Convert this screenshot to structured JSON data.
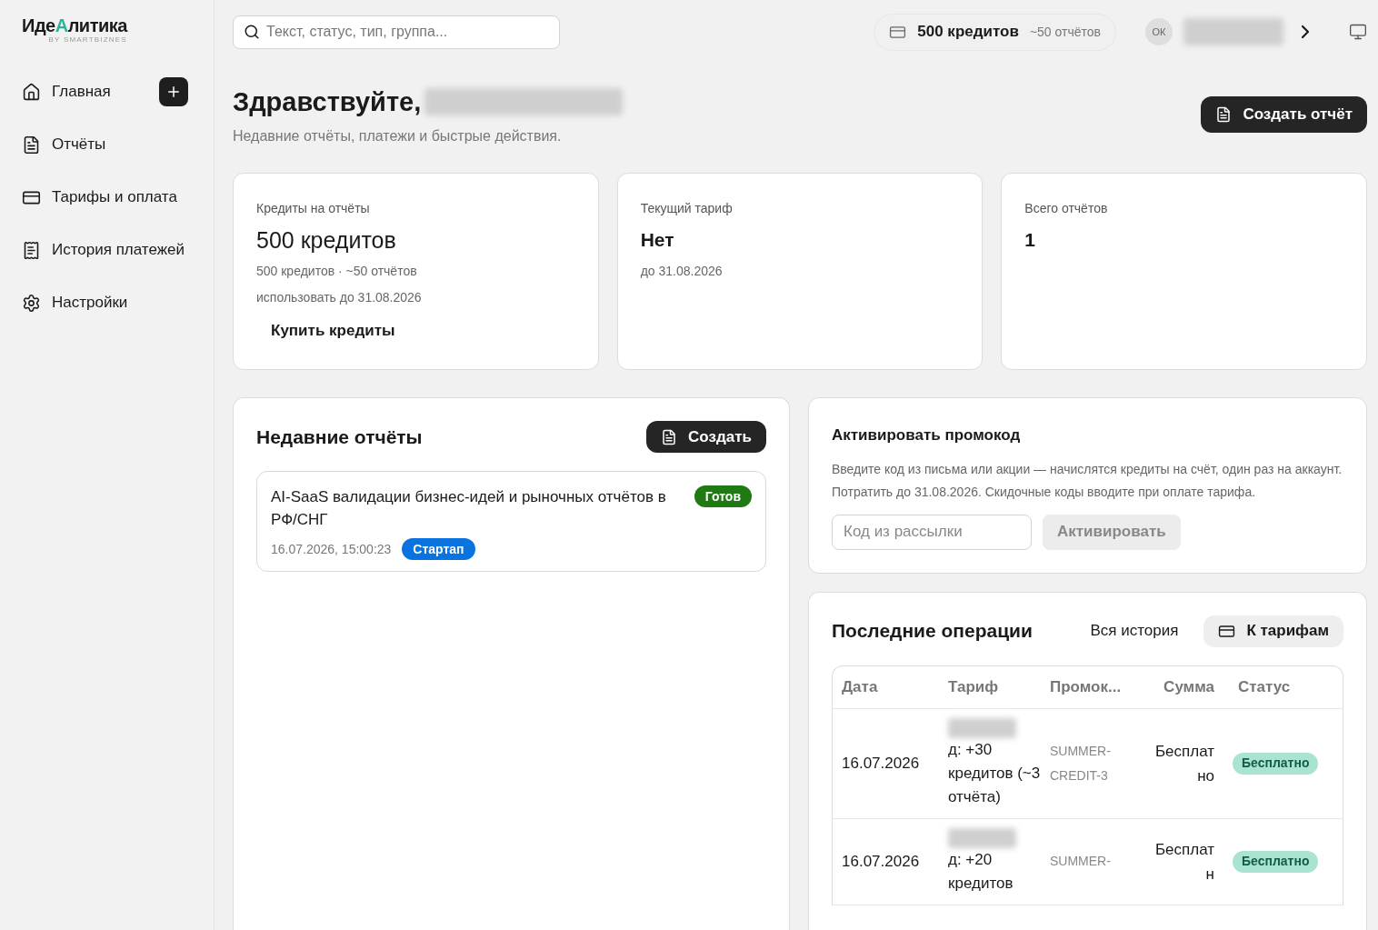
{
  "logo": {
    "name_start": "Иде",
    "name_accent": "А",
    "name_end": "литика",
    "tagline": "BY SMARTBIZNES"
  },
  "sidebar": {
    "items": [
      {
        "label": "Главная"
      },
      {
        "label": "Отчёты"
      },
      {
        "label": "Тарифы и оплата"
      },
      {
        "label": "История платежей"
      },
      {
        "label": "Настройки"
      }
    ]
  },
  "topbar": {
    "search_placeholder": "Текст, статус, тип, группа...",
    "credits": "500 кредитов",
    "reports_estimate": "~50 отчётов",
    "avatar": "ОК"
  },
  "header": {
    "greeting": "Здравствуйте,",
    "subtitle": "Недавние отчёты, платежи и быстрые действия.",
    "create_button": "Создать отчёт"
  },
  "stats": [
    {
      "label": "Кредиты на отчёты",
      "value": "500 кредитов",
      "lines": [
        "500 кредитов · ~50 отчётов",
        "использовать до 31.08.2026"
      ],
      "action": "Купить кредиты",
      "kind": "amount"
    },
    {
      "label": "Текущий тариф",
      "value": "Нет",
      "lines": [
        "до 31.08.2026"
      ],
      "kind": "plain"
    },
    {
      "label": "Всего отчётов",
      "value": "1",
      "kind": "plain"
    }
  ],
  "recent_reports": {
    "title": "Недавние отчёты",
    "create_button": "Создать",
    "items": [
      {
        "title": "AI-SaaS валидации бизнес-идей и рыночных отчётов в РФ/СНГ",
        "status": "Готов",
        "date": "16.07.2026, 15:00:23",
        "tag": "Стартап"
      }
    ]
  },
  "promo": {
    "title": "Активировать промокод",
    "text": "Введите код из письма или акции — начислятся кредиты на счёт, один раз на аккаунт. Потратить до 31.08.2026. Скидочные коды вводите при оплате тарифа.",
    "placeholder": "Код из рассылки",
    "button": "Активировать",
    "button_disabled": true
  },
  "operations": {
    "title": "Последние операции",
    "history_link": "Вся история",
    "tariffs_button": "К тарифам",
    "columns": [
      "Дата",
      "Тариф",
      "Промок...",
      "Сумма",
      "Статус"
    ],
    "rows": [
      {
        "date": "16.07.2026",
        "tariff": "д: +30 кредитов (~3 отчёта)",
        "promo": "SUMMER-CREDIT-3",
        "sum": "Бесплатно",
        "status": "Бесплатно"
      },
      {
        "date": "16.07.2026",
        "tariff": "д: +20 кредитов",
        "promo": "SUMMER-",
        "sum": "Бесплатн",
        "status": "Бесплатно"
      }
    ]
  }
}
